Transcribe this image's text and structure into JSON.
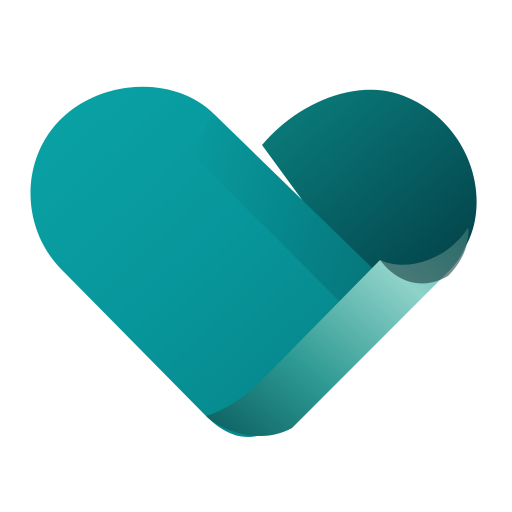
{
  "logo": {
    "icon": "folded-ribbon-heart-icon",
    "colors": {
      "background": "#ffffff",
      "main_teal": "#07959a",
      "main_teal_light": "#0aa3a6",
      "main_teal_dark": "#067f84",
      "back_lobe_light": "#0b817f",
      "back_lobe_dark": "#033f45",
      "fold_light": "#8fd2c9",
      "fold_mid": "#3aa79f",
      "fold_dark": "#0a5e5f",
      "edge_shadow": "#0c2f33"
    }
  }
}
